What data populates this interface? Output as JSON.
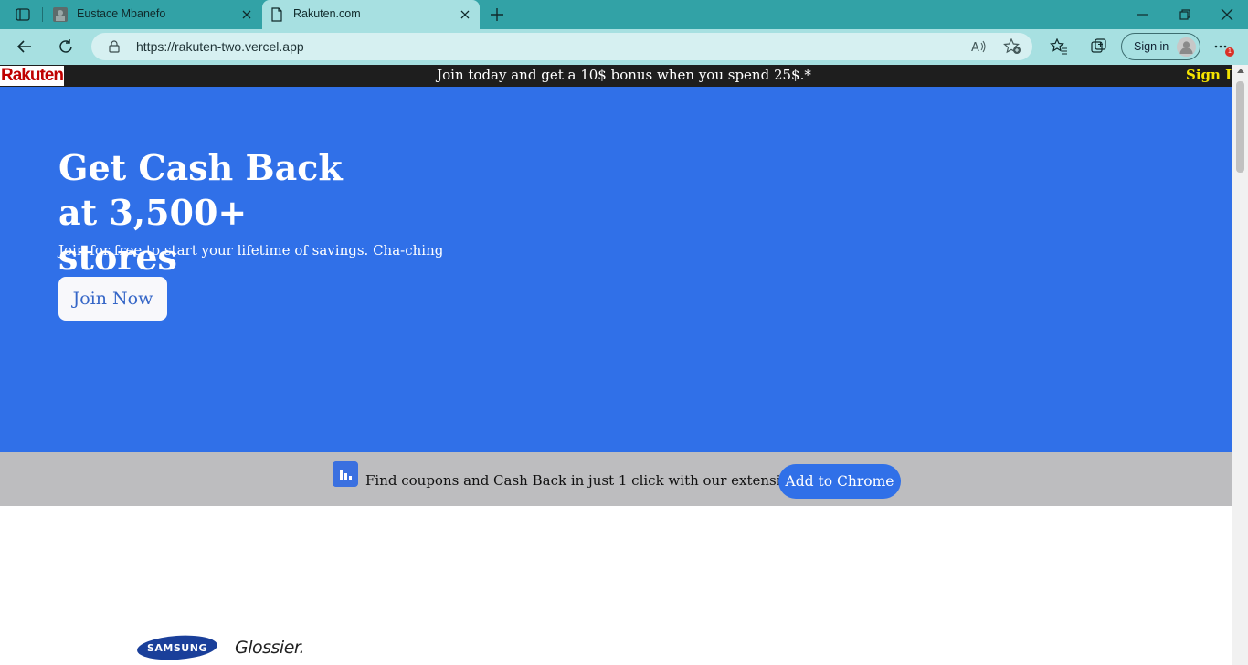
{
  "browser": {
    "tabs": [
      {
        "title": "Eustace Mbanefo",
        "active": false
      },
      {
        "title": "Rakuten.com",
        "active": true
      }
    ],
    "url": "https://rakuten-two.vercel.app",
    "signin_label": "Sign in",
    "notification_count": "1",
    "colors": {
      "tabstrip": "#32a2a6",
      "toolbar": "#a7e0e1"
    }
  },
  "page": {
    "logo": "Rakuten",
    "promo_text": "Join today and get a 10$ bonus when you spend 25$.*",
    "signin_link": "Sign In",
    "hero": {
      "title": "Get Cash Back at 3,500+ stores",
      "subtitle": "Join for free to start your lifetime of savings. Cha-ching",
      "cta": "Join Now"
    },
    "extension_band": {
      "text": "Find coupons and Cash Back in just 1 click with our extensions",
      "cta": "Add to Chrome"
    },
    "brands": [
      "SAMSUNG",
      "Glossier."
    ],
    "colors": {
      "hero": "#3070e8",
      "topbar": "#1e1e1e",
      "signin": "#f5e400",
      "band": "#bdbdbf"
    }
  }
}
